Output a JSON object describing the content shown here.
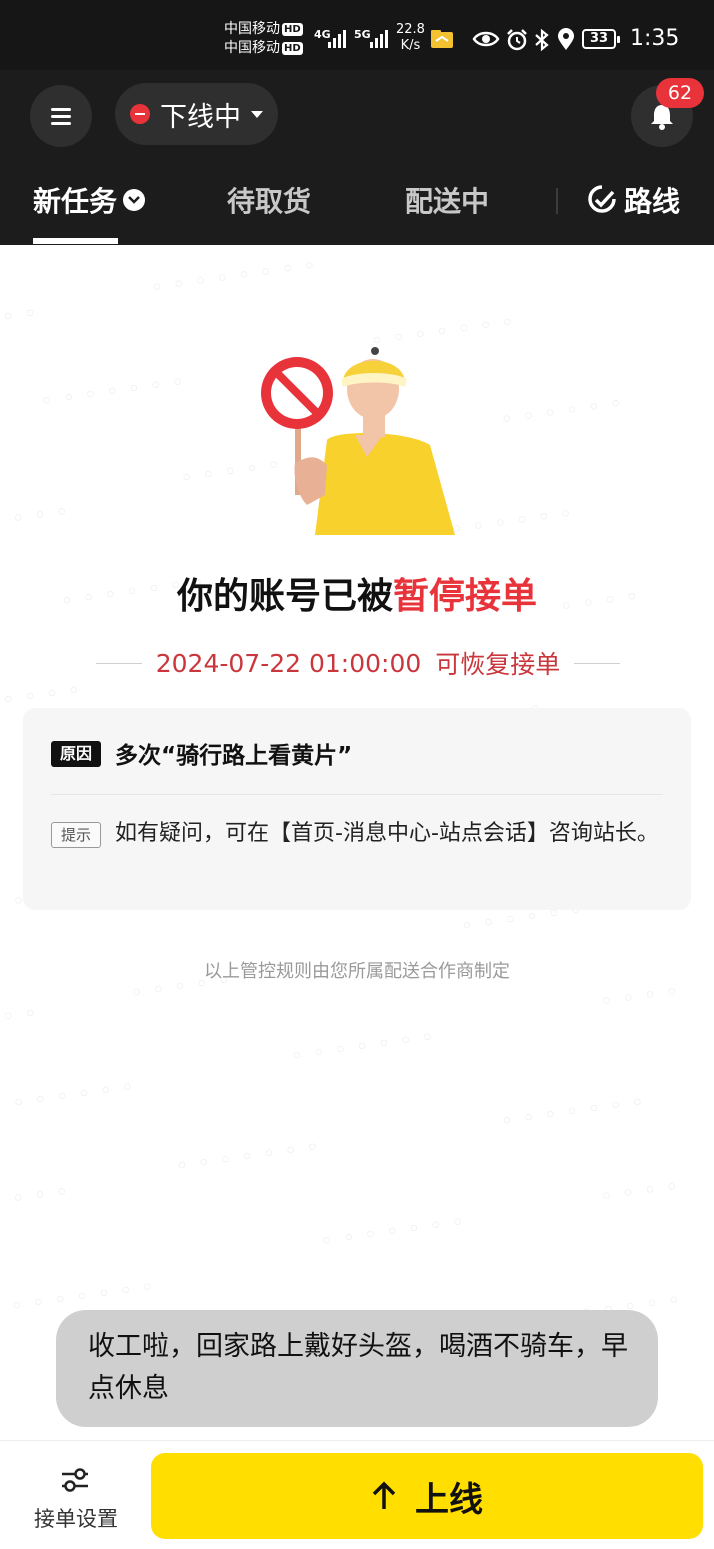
{
  "status_bar": {
    "carrier_1": "中国移动",
    "carrier_2": "中国移动",
    "hd": "HD",
    "net_1": "4G",
    "net_2": "5G",
    "speed_value": "22.8",
    "speed_unit": "K/s",
    "battery": "33",
    "time": "1:35"
  },
  "header": {
    "status": "下线中",
    "notification_count": "62"
  },
  "tabs": [
    {
      "label": "新任务"
    },
    {
      "label": "待取货"
    },
    {
      "label": "配送中"
    },
    {
      "label": "路线"
    }
  ],
  "notice": {
    "title_prefix": "你的账号已被",
    "title_highlight": "暂停接单",
    "resume_time": "2024-07-22 01:00:00",
    "resume_suffix": "可恢复接单",
    "reason_tag": "原因",
    "reason": "多次“骑行路上看黄片”",
    "tip_tag": "提示",
    "tip": "如有疑问，可在【首页-消息中心-站点会话】咨询站长。",
    "footnote": "以上管控规则由您所属配送合作商制定"
  },
  "toast": {
    "message": "收工啦，回家路上戴好头盔，喝酒不骑车，早点休息"
  },
  "bottom": {
    "settings_label": "接单设置",
    "online_label": "上线"
  },
  "colors": {
    "accent_red": "#e8333b",
    "primary_yellow": "#ffde00",
    "header_bg": "#1c1c1c"
  },
  "icons": [
    "menu-icon",
    "bell-icon",
    "chevron-down-icon",
    "route-pin-icon",
    "prohibited-sign-icon",
    "courier-illustration",
    "settings-sliders-icon",
    "arrow-up-icon"
  ]
}
